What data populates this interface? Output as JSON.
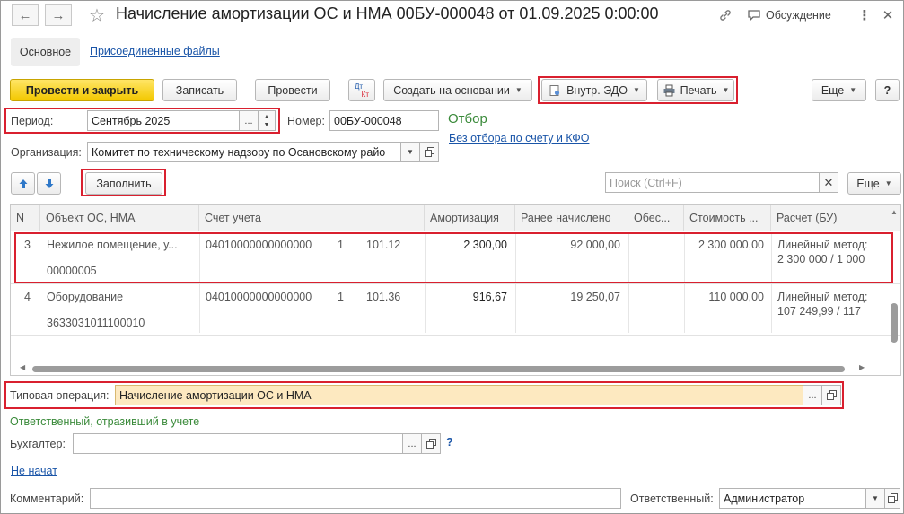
{
  "window": {
    "title": "Начисление амортизации ОС и НМА 00БУ-000048 от 01.09.2025 0:00:00",
    "discussion_label": "Обсуждение"
  },
  "tabs": {
    "main": "Основное",
    "attached": "Присоединенные файлы"
  },
  "toolbar": {
    "post_close": "Провести и закрыть",
    "save": "Записать",
    "post": "Провести",
    "dt_kt_top": "Дт",
    "dt_kt_bottom": "Кт",
    "create_based": "Создать на основании",
    "edo": "Внутр. ЭДО",
    "print": "Печать",
    "more": "Еще",
    "help": "?"
  },
  "header": {
    "period_label": "Период:",
    "period_value": "Сентябрь 2025",
    "number_label": "Номер:",
    "number_value": "00БУ-000048",
    "filter_label": "Отбор",
    "filter_link": "Без отбора по счету и КФО",
    "org_label": "Организация:",
    "org_value": "Комитет по техническому надзору по Осановскому райо"
  },
  "table_toolbar": {
    "fill": "Заполнить",
    "search_placeholder": "Поиск (Ctrl+F)",
    "more": "Еще"
  },
  "table": {
    "columns": [
      "N",
      "Объект ОС, НМА",
      "Счет учета",
      "Амортизация",
      "Ранее начислено",
      "Обес...",
      "Стоимость ...",
      "Расчет (БУ)"
    ],
    "rows": [
      {
        "n": "3",
        "object": "Нежилое помещение, у...",
        "object_code": "00000005",
        "account_code": "04010000000000000",
        "kfo": "1",
        "account": "101.12",
        "amortization": "2 300,00",
        "previous": "92 000,00",
        "security": "",
        "cost": "2 300 000,00",
        "calc_line1": "Линейный метод:",
        "calc_line2": "2 300 000 / 1 000"
      },
      {
        "n": "4",
        "object": "Оборудование",
        "object_code": "3633031011100010",
        "account_code": "04010000000000000",
        "kfo": "1",
        "account": "101.36",
        "amortization": "916,67",
        "previous": "19 250,07",
        "security": "",
        "cost": "110 000,00",
        "calc_line1": "Линейный метод:",
        "calc_line2": "107 249,99 / 117"
      }
    ]
  },
  "footer": {
    "operation_label": "Типовая операция:",
    "operation_value": "Начисление амортизации ОС и НМА",
    "responsible_section": "Ответственный, отразивший в учете",
    "accountant_label": "Бухгалтер:",
    "accountant_value": "",
    "not_started": "Не начат",
    "comment_label": "Комментарий:",
    "comment_value": "",
    "responsible_label": "Ответственный:",
    "responsible_value": "Администратор"
  },
  "colors": {
    "primary_button": "#f3c800",
    "highlight_red": "#d9202f",
    "link_blue": "#1a55a8",
    "green_text": "#3a8a3a",
    "operation_field_bg": "#fde9c0"
  }
}
